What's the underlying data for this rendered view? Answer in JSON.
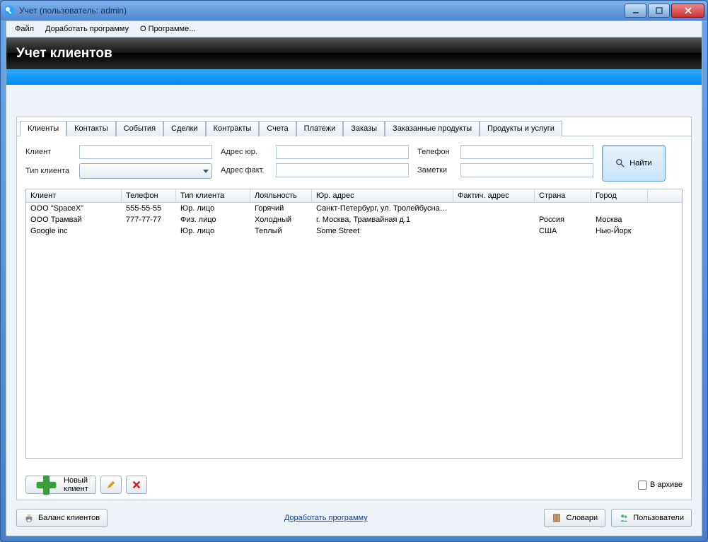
{
  "window_title": "Учет (пользователь: admin)",
  "menu": {
    "file": "Файл",
    "customize": "Доработать программу",
    "about": "О Программе..."
  },
  "banner_title": "Учет клиентов",
  "tabs": [
    {
      "label": "Клиенты",
      "active": true
    },
    {
      "label": "Контакты"
    },
    {
      "label": "События"
    },
    {
      "label": "Сделки"
    },
    {
      "label": "Контракты"
    },
    {
      "label": "Счета"
    },
    {
      "label": "Платежи"
    },
    {
      "label": "Заказы"
    },
    {
      "label": "Заказанные продукты"
    },
    {
      "label": "Продукты и услуги"
    }
  ],
  "filters": {
    "client_label": "Клиент",
    "type_label": "Тип клиента",
    "addr_legal_label": "Адрес юр.",
    "addr_fact_label": "Адрес факт.",
    "phone_label": "Телефон",
    "notes_label": "Заметки",
    "find_label": "Найти"
  },
  "grid": {
    "columns": [
      "Клиент",
      "Телефон",
      "Тип клиента",
      "Лояльность",
      "Юр. адрес",
      "Фактич. адрес",
      "Страна",
      "Город"
    ],
    "rows": [
      {
        "c0": "ООО \"SpaceX\"",
        "c1": "555-55-55",
        "c2": "Юр. лицо",
        "c3": "Горячий",
        "c4": "Санкт-Петербург, ул. Тролейбусная...",
        "c5": "",
        "c6": "",
        "c7": ""
      },
      {
        "c0": "ООО Трамвай",
        "c1": "777-77-77",
        "c2": "Физ. лицо",
        "c3": "Холодный",
        "c4": "г. Москва, Трамвайная д.1",
        "c5": "",
        "c6": "Россия",
        "c7": "Москва"
      },
      {
        "c0": "Google inc",
        "c1": "",
        "c2": "Юр. лицо",
        "c3": "Теплый",
        "c4": "Some Street",
        "c5": "",
        "c6": "США",
        "c7": "Нью-Йорк"
      }
    ]
  },
  "buttons": {
    "new_client": "Новый клиент",
    "archive_label": "В архиве",
    "balance": "Баланс клиентов",
    "dictionaries": "Словари",
    "users": "Пользователи",
    "footer_link": "Доработать программу"
  }
}
